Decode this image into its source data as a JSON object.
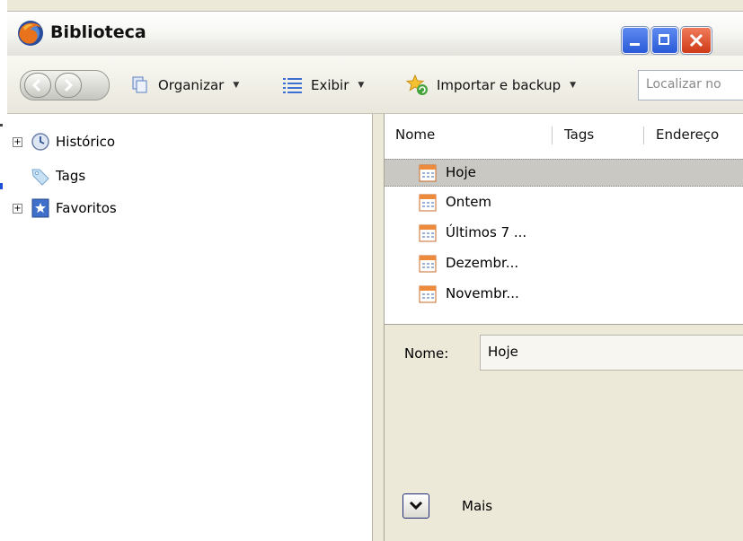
{
  "window": {
    "title": "Biblioteca"
  },
  "toolbar": {
    "organize_label": "Organizar",
    "view_label": "Exibir",
    "import_label": "Importar e backup",
    "search_placeholder": "Localizar no"
  },
  "sidebar": {
    "items": [
      {
        "label": "Histórico",
        "icon": "clock-icon",
        "expandable": true
      },
      {
        "label": "Tags",
        "icon": "tag-icon",
        "expandable": false
      },
      {
        "label": "Favoritos",
        "icon": "bookmark-star-icon",
        "expandable": true
      }
    ]
  },
  "list": {
    "columns": [
      "Nome",
      "Tags",
      "Endereço"
    ],
    "rows": [
      {
        "name": "Hoje",
        "selected": true
      },
      {
        "name": "Ontem"
      },
      {
        "name": "Últimos 7 ..."
      },
      {
        "name": "Dezembr..."
      },
      {
        "name": "Novembr..."
      }
    ]
  },
  "details": {
    "name_label": "Nome:",
    "name_value": "Hoje",
    "more_label": "Mais"
  },
  "colors": {
    "accent_blue": "#2a5bd8",
    "close_red": "#cf3a17",
    "selection": "#c9c8c2",
    "window_bg": "#ece9d8"
  }
}
